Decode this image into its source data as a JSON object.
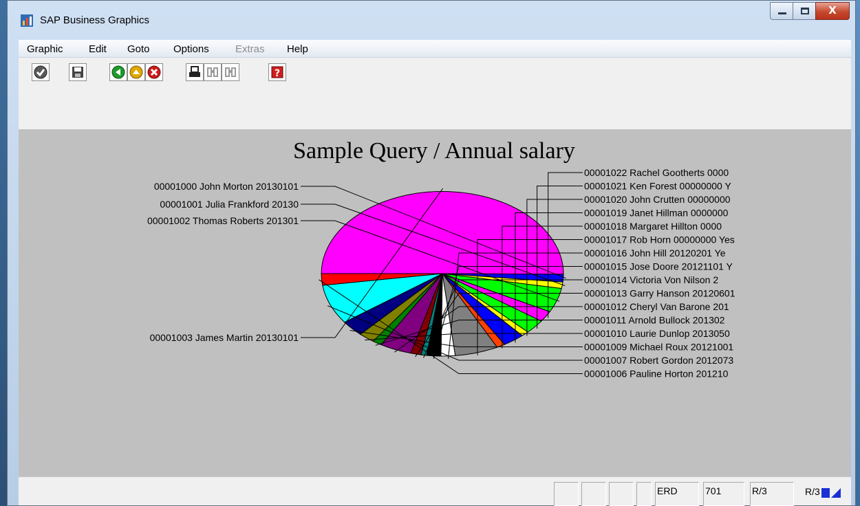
{
  "window": {
    "title": "SAP Business Graphics",
    "close_glyph": "X"
  },
  "menu": [
    "Graphic",
    "Edit",
    "Goto",
    "Options",
    "Extras",
    "Help"
  ],
  "toolbar": {
    "buttons": [
      "enter-icon",
      "save-icon",
      "back-icon",
      "exit-icon",
      "cancel-icon",
      "print-icon",
      "find-icon",
      "find-next-icon",
      "help-icon"
    ]
  },
  "chart_data": {
    "type": "pie",
    "title": "Sample Query / Annual salary",
    "slices": [
      {
        "label": "00001003 James Martin 20130101",
        "value": 40.0,
        "color": "#ff00ff"
      },
      {
        "label": "00001000 John Morton 20130101",
        "value": 1.2,
        "color": "#0000ff"
      },
      {
        "label": "00001001 Julia Frankford 20130",
        "value": 1.0,
        "color": "#ffff00"
      },
      {
        "label": "00001002 Thomas Roberts 201301",
        "value": 3.8,
        "color": "#00ff00"
      },
      {
        "label": "00001022 Rachel Gootherts 0000",
        "value": 1.7,
        "color": "#ff00ff"
      },
      {
        "label": "00001021 Ken Forest 00000000 Y",
        "value": 2.2,
        "color": "#00ff00"
      },
      {
        "label": "00001020 John Crutten 00000000",
        "value": 0.8,
        "color": "#ffff00"
      },
      {
        "label": "00001019 Janet Hillman 0000000",
        "value": 2.3,
        "color": "#0000ff"
      },
      {
        "label": "00001018 Margaret Hillton 0000",
        "value": 0.9,
        "color": "#ff4000"
      },
      {
        "label": "00001017 Rob Horn 00000000 Yes",
        "value": 4.6,
        "color": "#808080"
      },
      {
        "label": "00001016 John Hill 20120201 Ye",
        "value": 1.5,
        "color": "#ffffff"
      },
      {
        "label": "00001015 Jose Doore 20121101 Y",
        "value": 1.5,
        "color": "#000000"
      },
      {
        "label": "00001014 Victoria Von Nilson 2",
        "value": 0.6,
        "color": "#008080"
      },
      {
        "label": "00001013 Garry Hanson 20120601",
        "value": 1.1,
        "color": "#800000"
      },
      {
        "label": "00001012 Cheryl Van Barone 201",
        "value": 3.4,
        "color": "#800080"
      },
      {
        "label": "00001011 Arnold Bullock 201302",
        "value": 1.0,
        "color": "#008000"
      },
      {
        "label": "00001010 Laurie Dunlop 2013050",
        "value": 1.7,
        "color": "#808000"
      },
      {
        "label": "00001009 Michael Roux 20121001",
        "value": 2.5,
        "color": "#000080"
      },
      {
        "label": "00001007 Robert Gordon 2012073",
        "value": 6.2,
        "color": "#00ffff"
      },
      {
        "label": "00001006 Pauline Horton 201210",
        "value": 1.8,
        "color": "#ff0000"
      }
    ],
    "legend": "labels connected to slices by leader lines"
  },
  "statusbar": {
    "boxes": [
      "",
      "",
      "",
      "",
      "ERD",
      "701",
      "R/3"
    ],
    "system": "R/3"
  }
}
